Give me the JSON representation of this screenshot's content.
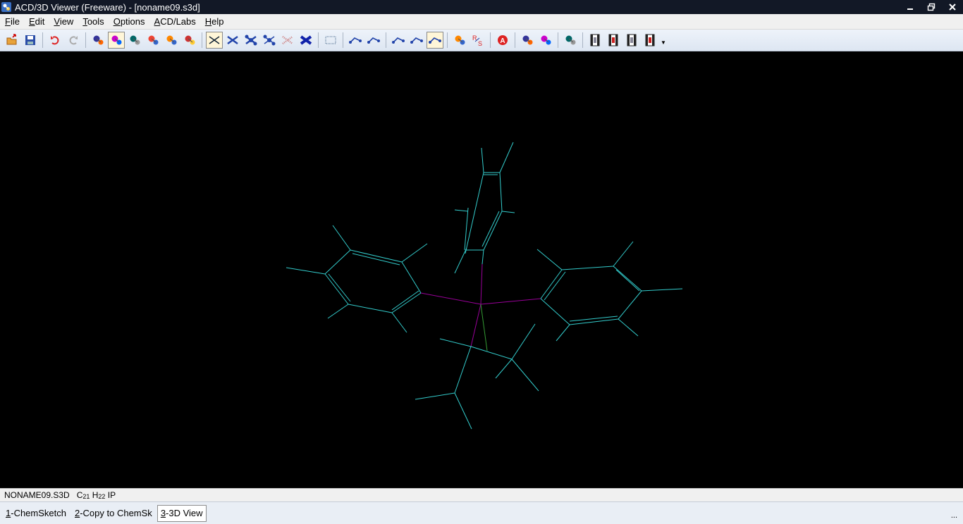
{
  "window": {
    "title": "ACD/3D Viewer (Freeware) - [noname09.s3d]",
    "controls": [
      "minimize",
      "restore",
      "close"
    ]
  },
  "menubar": {
    "items": [
      {
        "label": "File",
        "accesskey": "F"
      },
      {
        "label": "Edit",
        "accesskey": "E"
      },
      {
        "label": "View",
        "accesskey": "V"
      },
      {
        "label": "Tools",
        "accesskey": "T"
      },
      {
        "label": "Options",
        "accesskey": "O"
      },
      {
        "label": "ACD/Labs",
        "accesskey": "A"
      },
      {
        "label": "Help",
        "accesskey": "H"
      }
    ]
  },
  "toolbar": {
    "buttons": [
      {
        "name": "open-icon"
      },
      {
        "name": "save-icon"
      },
      {
        "name": "undo-icon"
      },
      {
        "name": "redo-icon"
      },
      {
        "name": "select-atom-icon"
      },
      {
        "name": "rotate-molecule-icon",
        "pressed": true
      },
      {
        "name": "rotate-z-icon"
      },
      {
        "name": "move-icon"
      },
      {
        "name": "move-xy-icon"
      },
      {
        "name": "zoom-icon"
      },
      {
        "name": "wireframe-icon",
        "pressed": true
      },
      {
        "name": "sticks-icon"
      },
      {
        "name": "balls-sticks-icon"
      },
      {
        "name": "spacefill-icon"
      },
      {
        "name": "dots-surface-icon"
      },
      {
        "name": "disks-icon"
      },
      {
        "name": "show-grid-icon"
      },
      {
        "name": "measure-distance-icon"
      },
      {
        "name": "measure-angle-icon"
      },
      {
        "name": "bond-length-icon"
      },
      {
        "name": "bond-angle-icon"
      },
      {
        "name": "torsion-angle-icon",
        "pressed": true
      },
      {
        "name": "optimize-icon"
      },
      {
        "name": "rs-label-icon"
      },
      {
        "name": "atom-label-icon"
      },
      {
        "name": "orbital-icon"
      },
      {
        "name": "electron-density-icon"
      },
      {
        "name": "show-hydrogens-icon"
      },
      {
        "name": "film-1-icon"
      },
      {
        "name": "film-2-icon"
      },
      {
        "name": "film-3-icon"
      },
      {
        "name": "film-4-icon"
      }
    ]
  },
  "status": {
    "filename": "NONAME09.S3D",
    "formula": [
      {
        "el": "C",
        "n": "21"
      },
      {
        "el": "H",
        "n": "22"
      },
      {
        "el": "IP",
        "n": ""
      }
    ]
  },
  "tabs": [
    {
      "key": "1",
      "label": "-ChemSketch",
      "active": false
    },
    {
      "key": "2",
      "label": "-Copy to ChemSk",
      "active": false
    },
    {
      "key": "3",
      "label": "-3D View",
      "active": true
    }
  ],
  "colors": {
    "bond": "#33cccc",
    "phosphorus_bond": "#990099",
    "iodine_bond": "#339933",
    "background": "#000000"
  },
  "molecule": {
    "bonds": [
      [
        683,
        210,
        686,
        245,
        "c"
      ],
      [
        728,
        202,
        709,
        245,
        "c"
      ],
      [
        686,
        245,
        709,
        245,
        "c"
      ],
      [
        686,
        248,
        706,
        248,
        "c"
      ],
      [
        686,
        245,
        660,
        360,
        "c"
      ],
      [
        709,
        245,
        712,
        300,
        "c"
      ],
      [
        712,
        300,
        686,
        355,
        "c"
      ],
      [
        708,
        300,
        684,
        350,
        "c"
      ],
      [
        712,
        300,
        730,
        302,
        "c"
      ],
      [
        664,
        300,
        645,
        298,
        "c"
      ],
      [
        662,
        352,
        645,
        388,
        "c"
      ],
      [
        686,
        355,
        684,
        375,
        "c"
      ],
      [
        664,
        295,
        659,
        355,
        "c"
      ],
      [
        660,
        355,
        686,
        355,
        "c"
      ],
      [
        684,
        375,
        682,
        432,
        "p"
      ],
      [
        472,
        320,
        497,
        355,
        "c"
      ],
      [
        497,
        355,
        570,
        372,
        "c"
      ],
      [
        500,
        360,
        567,
        376,
        "c"
      ],
      [
        570,
        372,
        606,
        346,
        "c"
      ],
      [
        570,
        372,
        597,
        416,
        "c"
      ],
      [
        497,
        355,
        461,
        389,
        "c"
      ],
      [
        461,
        389,
        406,
        380,
        "c"
      ],
      [
        461,
        389,
        494,
        432,
        "c"
      ],
      [
        466,
        389,
        497,
        428,
        "c"
      ],
      [
        494,
        432,
        556,
        444,
        "c"
      ],
      [
        494,
        432,
        465,
        452,
        "c"
      ],
      [
        556,
        444,
        597,
        416,
        "c"
      ],
      [
        556,
        440,
        594,
        413,
        "c"
      ],
      [
        556,
        444,
        577,
        472,
        "c"
      ],
      [
        597,
        416,
        682,
        432,
        "p"
      ],
      [
        762,
        354,
        797,
        383,
        "c"
      ],
      [
        797,
        383,
        870,
        378,
        "c"
      ],
      [
        870,
        378,
        898,
        343,
        "c"
      ],
      [
        870,
        378,
        910,
        413,
        "c"
      ],
      [
        874,
        383,
        907,
        413,
        "c"
      ],
      [
        910,
        413,
        968,
        410,
        "c"
      ],
      [
        910,
        413,
        877,
        453,
        "c"
      ],
      [
        877,
        453,
        905,
        477,
        "c"
      ],
      [
        877,
        453,
        808,
        461,
        "c"
      ],
      [
        876,
        449,
        808,
        456,
        "c"
      ],
      [
        808,
        461,
        789,
        484,
        "c"
      ],
      [
        808,
        461,
        767,
        424,
        "c"
      ],
      [
        797,
        383,
        767,
        424,
        "c"
      ],
      [
        802,
        386,
        772,
        426,
        "c"
      ],
      [
        767,
        424,
        682,
        432,
        "p"
      ],
      [
        682,
        432,
        668,
        492,
        "p"
      ],
      [
        682,
        432,
        691,
        498,
        "i"
      ],
      [
        668,
        492,
        624,
        481,
        "c"
      ],
      [
        668,
        492,
        726,
        510,
        "c"
      ],
      [
        726,
        510,
        759,
        460,
        "c"
      ],
      [
        726,
        510,
        764,
        555,
        "c"
      ],
      [
        726,
        510,
        703,
        537,
        "c"
      ],
      [
        668,
        492,
        645,
        558,
        "c"
      ],
      [
        645,
        558,
        589,
        567,
        "c"
      ],
      [
        645,
        558,
        669,
        609,
        "c"
      ]
    ]
  }
}
